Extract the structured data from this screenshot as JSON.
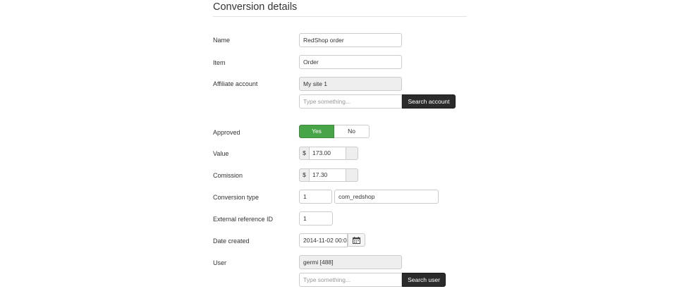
{
  "section": {
    "title": "Conversion details"
  },
  "form": {
    "name": {
      "label": "Name",
      "value": "RedShop order"
    },
    "item": {
      "label": "Item",
      "value": "Order"
    },
    "affiliate": {
      "label": "Affiliate account",
      "value": "My site 1",
      "search_placeholder": "Type something...",
      "search_button": "Search account"
    },
    "approved": {
      "label": "Approved",
      "yes": "Yes",
      "no": "No",
      "selected": "Yes"
    },
    "value": {
      "label": "Value",
      "currency": "$",
      "amount": "173.00"
    },
    "commission": {
      "label": "Comission",
      "currency": "$",
      "amount": "17.30"
    },
    "conversion_type": {
      "label": "Conversion type",
      "id": "1",
      "name": "com_redshop"
    },
    "external_ref": {
      "label": "External reference ID",
      "value": "1"
    },
    "date_created": {
      "label": "Date created",
      "value": "2014-11-02 00:0",
      "icon": "calendar-icon"
    },
    "user": {
      "label": "User",
      "value": "germi [488]",
      "search_placeholder": "Type something...",
      "search_button": "Search user"
    }
  },
  "colors": {
    "approved_green": "#47a447",
    "dark_button": "#2b2b2b",
    "readonly_bg": "#eeeeee"
  }
}
